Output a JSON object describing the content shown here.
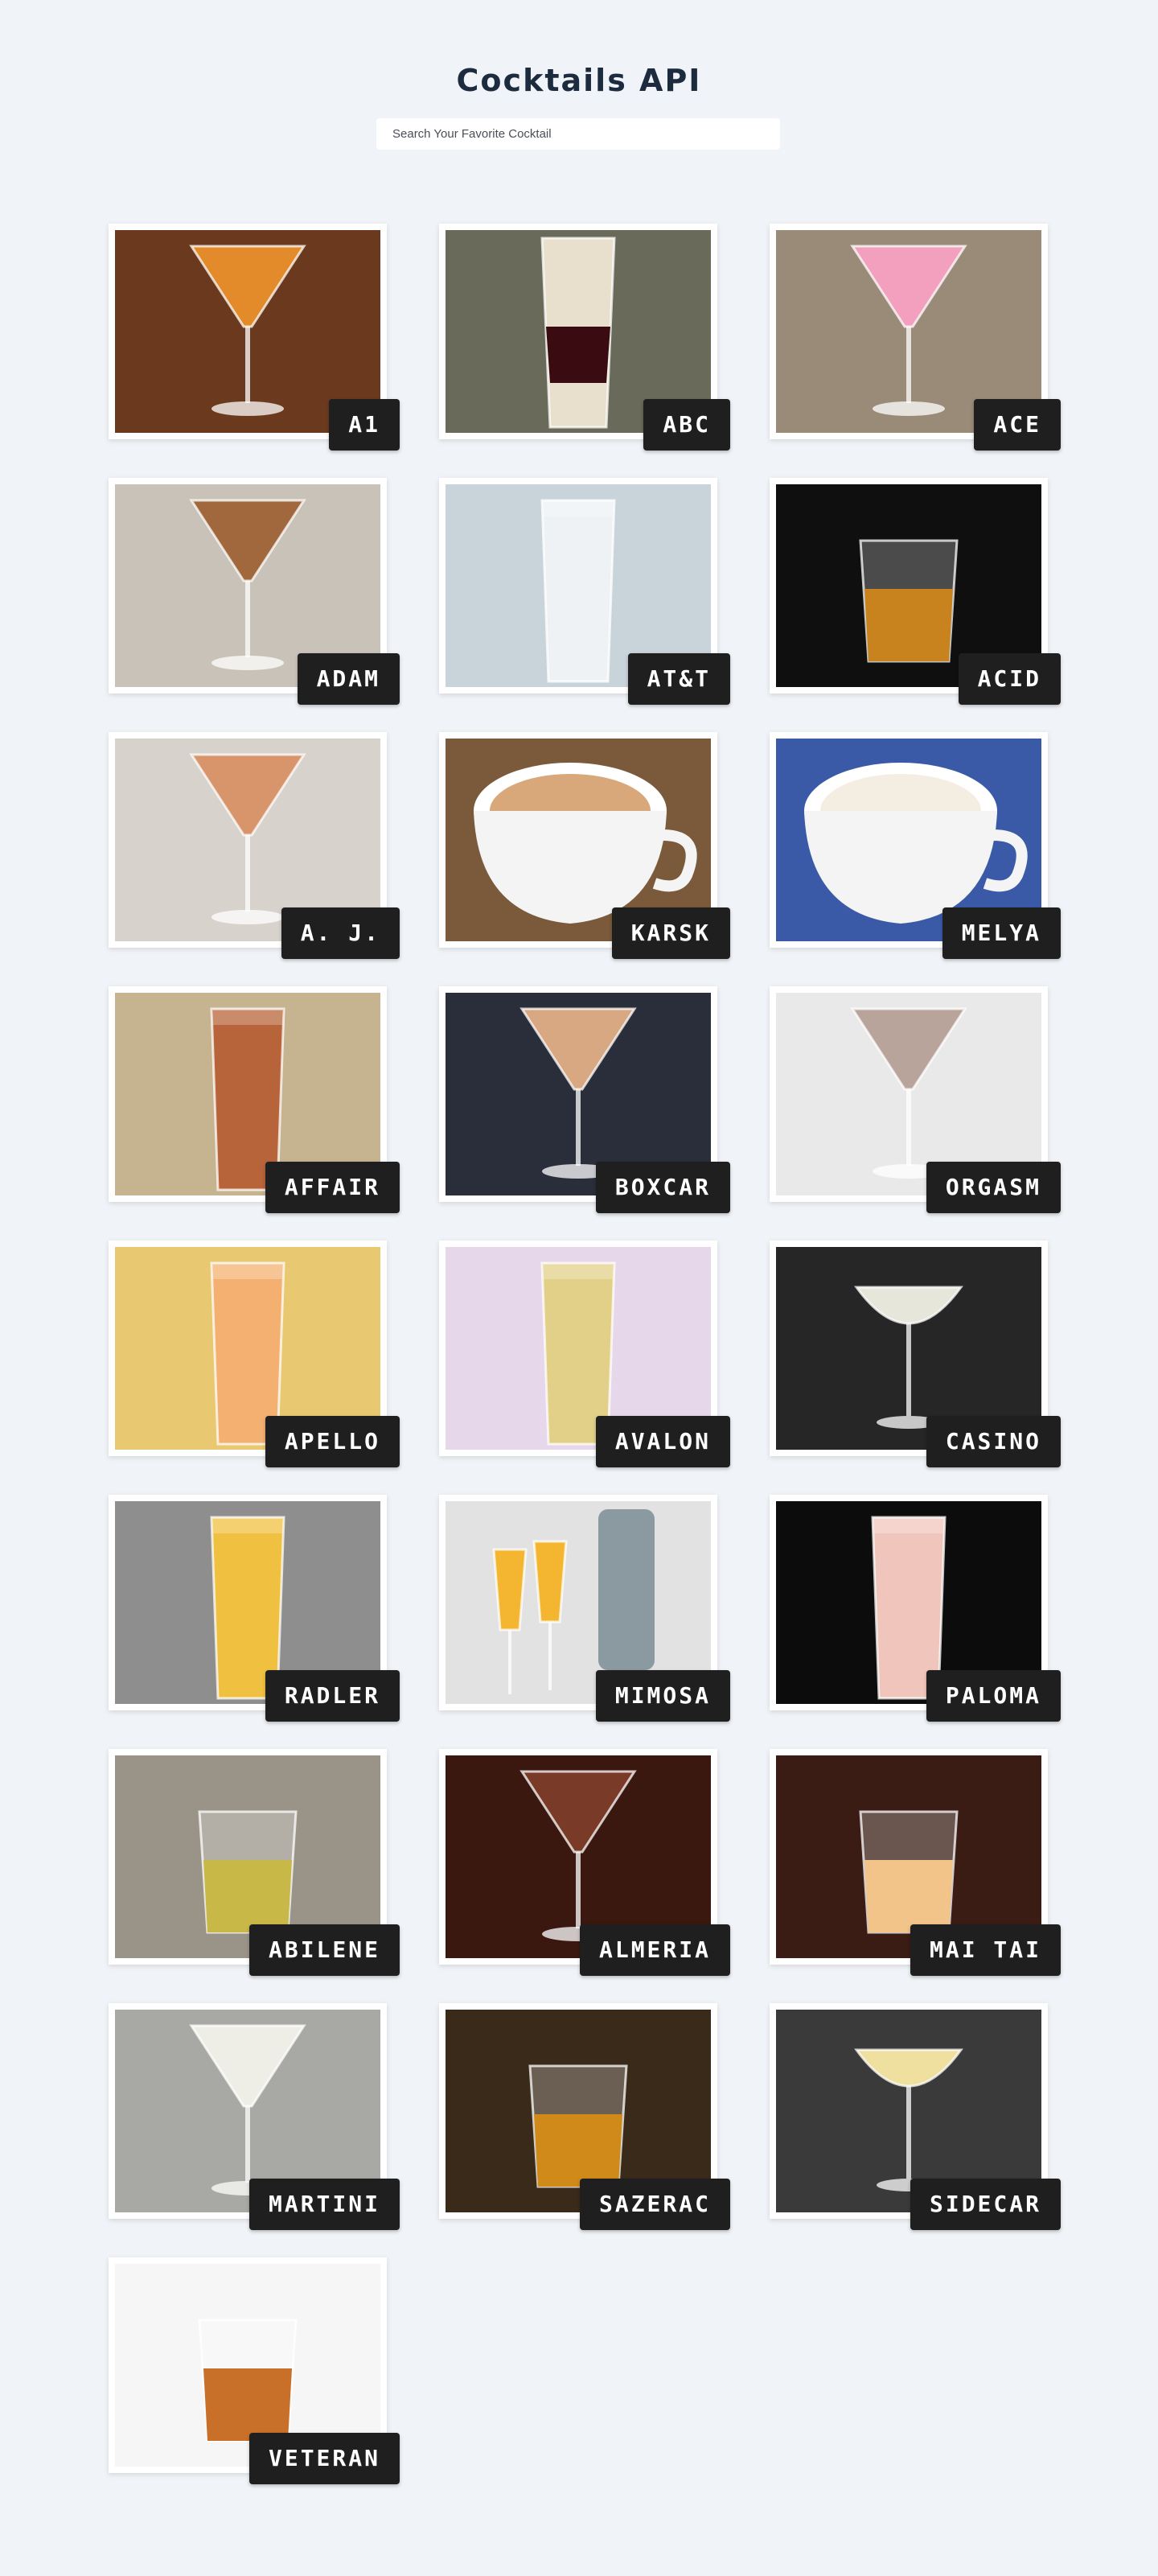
{
  "header": {
    "title": "Cocktails API"
  },
  "search": {
    "placeholder": "Search Your Favorite Cocktail",
    "value": ""
  },
  "cocktails": [
    {
      "name": "A1",
      "bg": "#6b3a1e",
      "liquid": "#e38a2a",
      "glass": "martini"
    },
    {
      "name": "ABC",
      "bg": "#6a6a5a",
      "liquid": "#e8e0cc",
      "glass": "shot"
    },
    {
      "name": "ACE",
      "bg": "#9a8a78",
      "liquid": "#f2a0be",
      "glass": "martini"
    },
    {
      "name": "ADAM",
      "bg": "#c9c2b8",
      "liquid": "#a0683c",
      "glass": "martini"
    },
    {
      "name": "AT&T",
      "bg": "#c9d3da",
      "liquid": "#eef2f4",
      "glass": "highball"
    },
    {
      "name": "ACID",
      "bg": "#0f0f0f",
      "liquid": "#c8821e",
      "glass": "rocks"
    },
    {
      "name": "A. J.",
      "bg": "#d8d2cc",
      "liquid": "#d8946a",
      "glass": "martini"
    },
    {
      "name": "KARSK",
      "bg": "#7a5a3a",
      "liquid": "#d8a77a",
      "glass": "cup"
    },
    {
      "name": "MELYA",
      "bg": "#3a5aa8",
      "liquid": "#f4ede2",
      "glass": "cup"
    },
    {
      "name": "AFFAIR",
      "bg": "#c6b390",
      "liquid": "#b8643a",
      "glass": "highball"
    },
    {
      "name": "BOXCAR",
      "bg": "#2a2e3a",
      "liquid": "#d8a882",
      "glass": "martini"
    },
    {
      "name": "ORGASM",
      "bg": "#e9e9e9",
      "liquid": "#b8a49a",
      "glass": "martini"
    },
    {
      "name": "APELLO",
      "bg": "#e8c870",
      "liquid": "#f4b070",
      "glass": "highball"
    },
    {
      "name": "AVALON",
      "bg": "#e6d8ea",
      "liquid": "#e2d088",
      "glass": "highball"
    },
    {
      "name": "CASINO",
      "bg": "#262626",
      "liquid": "#e6e6da",
      "glass": "coupe"
    },
    {
      "name": "RADLER",
      "bg": "#8e8e8e",
      "liquid": "#f0c040",
      "glass": "highball"
    },
    {
      "name": "MIMOSA",
      "bg": "#e2e2e2",
      "liquid": "#f4b630",
      "glass": "flute"
    },
    {
      "name": "PALOMA",
      "bg": "#0c0c0c",
      "liquid": "#f0c6bc",
      "glass": "highball"
    },
    {
      "name": "ABILENE",
      "bg": "#9a9488",
      "liquid": "#c8b848",
      "glass": "rocks"
    },
    {
      "name": "ALMERIA",
      "bg": "#3a1810",
      "liquid": "#7a3a28",
      "glass": "martini"
    },
    {
      "name": "MAI TAI",
      "bg": "#3a1c14",
      "liquid": "#f2c48a",
      "glass": "rocks"
    },
    {
      "name": "MARTINI",
      "bg": "#a8a8a4",
      "liquid": "#eeeee6",
      "glass": "martini"
    },
    {
      "name": "SAZERAC",
      "bg": "#3a2a1a",
      "liquid": "#d08a1a",
      "glass": "rocks"
    },
    {
      "name": "SIDECAR",
      "bg": "#3a3a3a",
      "liquid": "#f0e0a0",
      "glass": "coupe"
    },
    {
      "name": "VETERAN",
      "bg": "#f6f6f6",
      "liquid": "#c8702a",
      "glass": "rocks"
    }
  ]
}
